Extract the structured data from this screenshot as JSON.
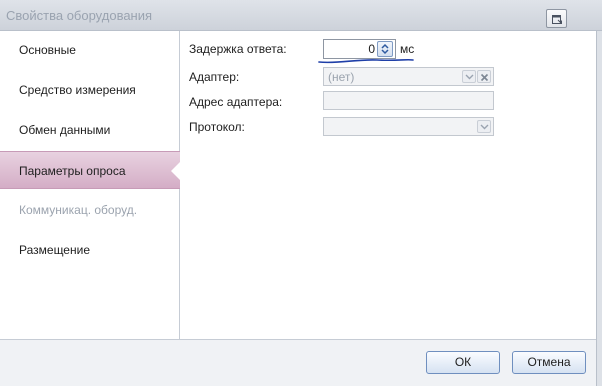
{
  "window": {
    "title": "Свойства оборудования"
  },
  "sidebar": {
    "items": [
      {
        "label": "Основные",
        "state": "normal"
      },
      {
        "label": "Средство измерения",
        "state": "normal"
      },
      {
        "label": "Обмен данными",
        "state": "normal"
      },
      {
        "label": "Параметры опроса",
        "state": "selected"
      },
      {
        "label": "Коммуникац. оборуд.",
        "state": "disabled"
      },
      {
        "label": "Размещение",
        "state": "normal"
      }
    ]
  },
  "form": {
    "response_delay": {
      "label": "Задержка ответа:",
      "value": "0",
      "unit": "мс"
    },
    "adapter": {
      "label": "Адаптер:",
      "value": "(нет)",
      "enabled": false
    },
    "adapter_address": {
      "label": "Адрес адаптера:",
      "value": "",
      "enabled": false
    },
    "protocol": {
      "label": "Протокол:",
      "value": "",
      "enabled": false
    }
  },
  "footer": {
    "ok_label": "ОК",
    "cancel_label": "Отмена"
  },
  "colors": {
    "selected_nav": "#d4adc6",
    "annotation_ink": "#1f3fa8",
    "button_border": "#6f8fbf"
  }
}
